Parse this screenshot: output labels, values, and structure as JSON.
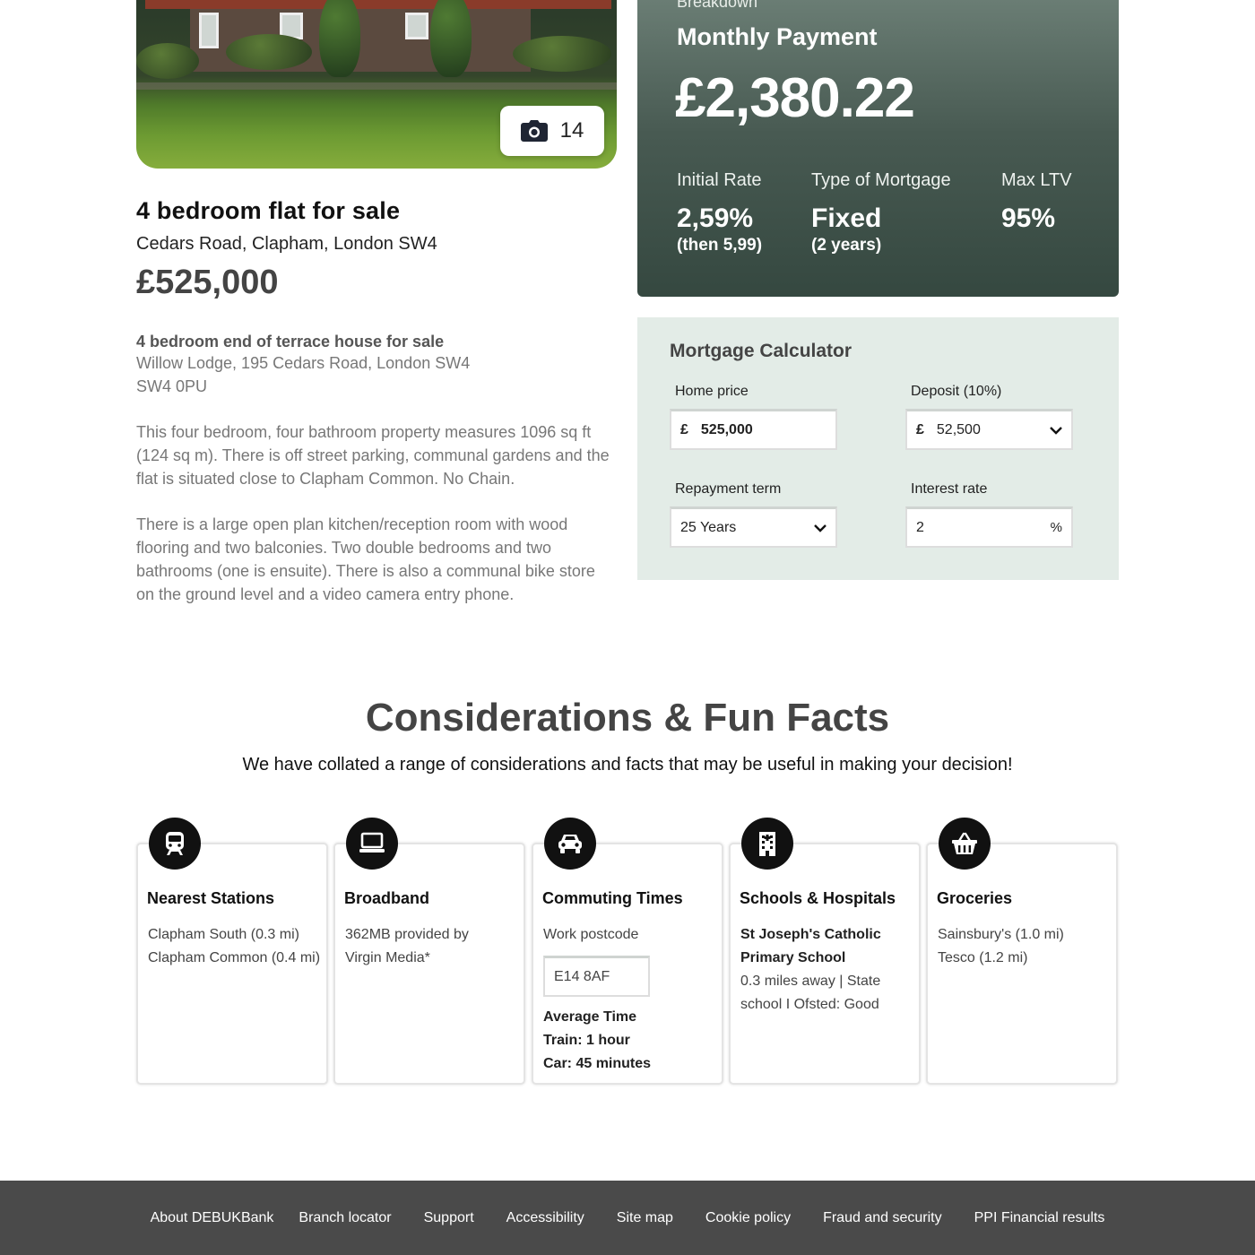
{
  "property": {
    "photo_count": "14",
    "title": "4 bedroom flat for sale",
    "address": "Cedars Road, Clapham, London SW4",
    "price": "£525,000",
    "subtitle": "4 bedroom end of terrace house for sale",
    "address_line1": "Willow Lodge, 195 Cedars Road, London SW4",
    "address_line2": "SW4 0PU",
    "description": [
      "This four bedroom, four bathroom property measures 1096 sq ft (124 sq m). There is off street parking, communal gardens and the flat is situated close to Clapham Common. No Chain.",
      "There is a large open plan kitchen/reception room with wood flooring and two balconies. Two double bedrooms and two bathrooms (one is ensuite). There is also a communal bike store on the ground level and a video camera entry phone."
    ]
  },
  "breakdown": {
    "kicker": "Breakdown",
    "label": "Monthly Payment",
    "amount": "£2,380.22",
    "metrics": [
      {
        "label": "Initial Rate",
        "value": "2,59%",
        "note": "(then 5,99)"
      },
      {
        "label": "Type of Mortgage",
        "value": "Fixed",
        "note": "(2 years)"
      },
      {
        "label": "Max LTV",
        "value": "95%",
        "note": ""
      }
    ]
  },
  "calculator": {
    "title": "Mortgage Calculator",
    "home_price": {
      "label": "Home price",
      "currency": "£",
      "value": "525,000"
    },
    "deposit": {
      "label": "Deposit (10%)",
      "currency": "£",
      "value": "52,500"
    },
    "repayment_term": {
      "label": "Repayment term",
      "value": "25 Years"
    },
    "interest_rate": {
      "label": "Interest rate",
      "value": "2",
      "unit": "%"
    }
  },
  "considerations": {
    "title": "Considerations & Fun Facts",
    "subtitle": "We have collated a range of considerations and facts that may be useful in making your decision!",
    "stations": {
      "title": "Nearest Stations",
      "icon": "train-icon",
      "lines": [
        "Clapham South (0.3 mi)",
        "Clapham Common (0.4 mi)"
      ]
    },
    "broadband": {
      "title": "Broadband",
      "icon": "laptop-icon",
      "lines": [
        "362MB provided by",
        "Virgin Media*"
      ]
    },
    "commuting": {
      "title": "Commuting Times",
      "icon": "car-icon",
      "postcode_label": "Work postcode",
      "postcode_value": "E14 8AF",
      "avg_label": "Average Time",
      "train": "Train: 1 hour",
      "car": "Car: 45 minutes"
    },
    "schools": {
      "title": "Schools & Hospitals",
      "icon": "building-icon",
      "name_line1": "St Joseph's Catholic",
      "name_line2": "Primary School",
      "detail_line1": "0.3 miles away | State",
      "detail_line2": "school I Ofsted: Good"
    },
    "groceries": {
      "title": "Groceries",
      "icon": "basket-icon",
      "lines": [
        "Sainsbury's (1.0 mi)",
        "Tesco (1.2 mi)"
      ]
    }
  },
  "footer": {
    "links": [
      "About DEBUKBank",
      "Branch locator",
      "Support",
      "Accessibility",
      "Site map",
      "Cookie policy",
      "Fraud and security",
      "PPI Financial results"
    ]
  },
  "colors": {
    "breakdown_top": "#6a7d74",
    "breakdown_bottom": "#354840",
    "calculator_bg": "#e3ece7",
    "footer_bg": "#4a4a4a"
  }
}
